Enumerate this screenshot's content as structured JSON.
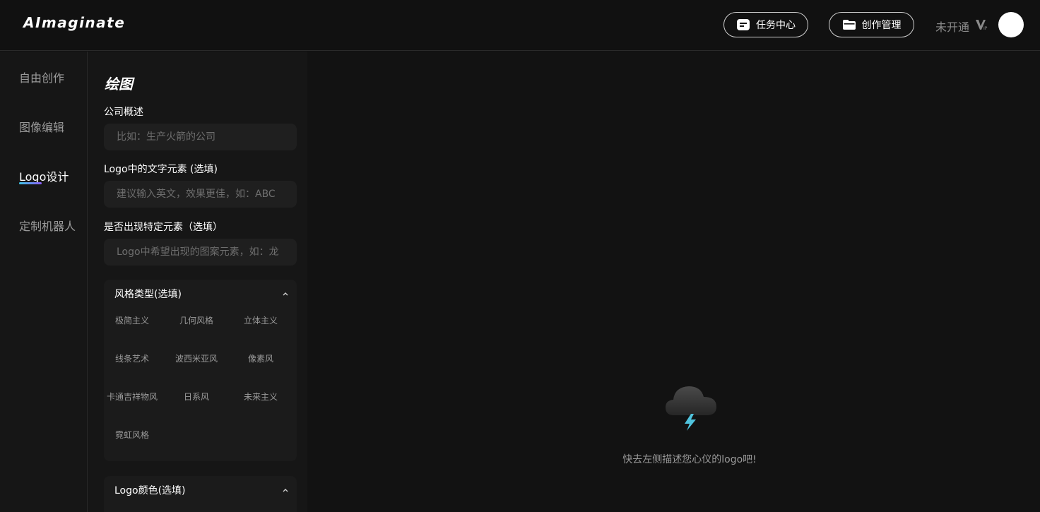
{
  "header": {
    "brand": "AImaginate",
    "task_center_label": "任务中心",
    "creation_manage_label": "创作管理",
    "vip_status": "未开通",
    "vip_badge_icon": "vip-badge-icon"
  },
  "sidebar": {
    "items": [
      {
        "label": "自由创作"
      },
      {
        "label": "图像编辑"
      },
      {
        "label": "Logo设计"
      },
      {
        "label": "定制机器人"
      }
    ],
    "active": "Logo设计",
    "accent_gradient": [
      "#3fc7e8",
      "#8a5cf6"
    ]
  },
  "panel": {
    "title": "绘图",
    "company": {
      "label": "公司概述",
      "value": "",
      "placeholder": "比如：生产火箭的公司"
    },
    "text_element": {
      "label": "Logo中的文字元素 (选填)",
      "value": "",
      "placeholder": "建议输入英文，效果更佳，如：ABC"
    },
    "special_element": {
      "label": "是否出现特定元素（选填）",
      "value": "",
      "placeholder": "Logo中希望出现的图案元素，如：龙"
    },
    "style": {
      "title": "风格类型(选填)",
      "options": [
        "极简主义",
        "几何风格",
        "立体主义",
        "线条艺术",
        "波西米亚风",
        "像素风",
        "卡通吉祥物风",
        "日系风",
        "未来主义",
        "霓虹风格"
      ]
    },
    "color": {
      "title": "Logo颜色(选填)"
    }
  },
  "main": {
    "empty_icon": "cloud-lightning-icon",
    "empty_text": "快去左侧描述您心仪的logo吧!"
  }
}
